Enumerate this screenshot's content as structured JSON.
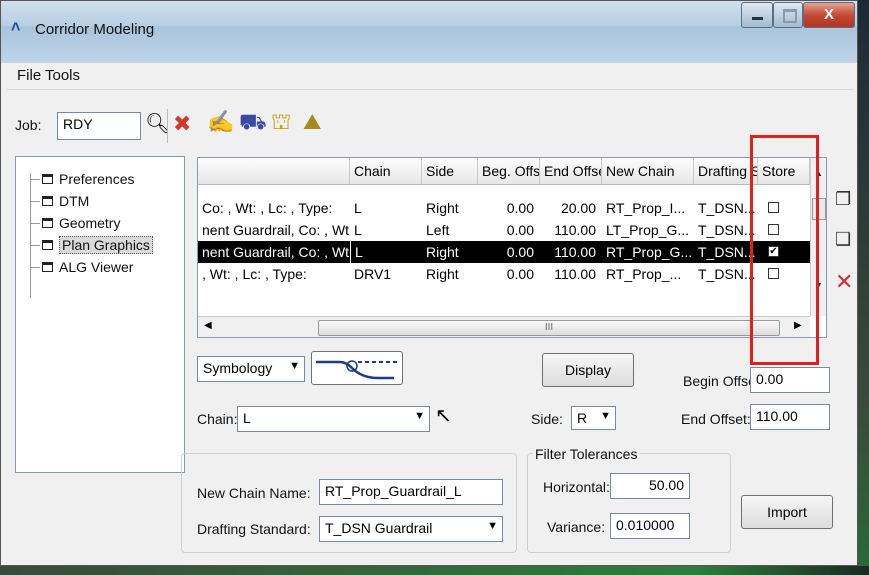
{
  "window": {
    "title": "Corridor Modeling"
  },
  "menu": [
    "File",
    "Tools"
  ],
  "toolbar": {
    "job_label": "Job:",
    "job_value": "RDY"
  },
  "tree": [
    "Preferences",
    "DTM",
    "Geometry",
    "Plan Graphics",
    "ALG Viewer"
  ],
  "grid": {
    "headers": [
      "",
      "Chain",
      "Side",
      "Beg. Offse",
      "End Offse",
      "New Chain",
      "Drafting S",
      "Store"
    ],
    "rows": [
      [
        "Co: , Wt: , Lc: , Type:",
        "L",
        "Right",
        "0.00",
        "20.00",
        "RT_Prop_I...",
        "T_DSN...",
        false
      ],
      [
        "nent Guardrail, Co: , Wt...",
        "L",
        "Left",
        "0.00",
        "110.00",
        "LT_Prop_G...",
        "T_DSN...",
        false
      ],
      [
        "nent Guardrail, Co: , Wt...",
        "L",
        "Right",
        "0.00",
        "110.00",
        "RT_Prop_G...",
        "T_DSN...",
        true
      ],
      [
        ", Wt: , Lc: , Type:",
        "DRV1",
        "Right",
        "0.00",
        "110.00",
        "RT_Prop_...",
        "T_DSN...",
        false
      ]
    ],
    "scroll_thumb": "III"
  },
  "form": {
    "symbology": "Symbology",
    "chain_label": "Chain:",
    "chain_value": "L",
    "display_button": "Display",
    "begin_offset_label": "Begin Offset:",
    "begin_offset_value": "0.00",
    "side_label": "Side:",
    "side_value": "R",
    "end_offset_label": "End Offset:",
    "end_offset_value": "110.00",
    "new_chain_label": "New Chain Name:",
    "new_chain_value": "RT_Prop_Guardrail_L",
    "drafting_label": "Drafting Standard:",
    "drafting_value": "T_DSN Guardrail",
    "filter_title": "Filter Tolerances",
    "horizontal_label": "Horizontal:",
    "horizontal_value": "50.00",
    "variance_label": "Variance:",
    "variance_value": "0.010000",
    "import_button": "Import"
  },
  "colors": {
    "selection_row": "#000000",
    "callout": "#e02020",
    "delete": "#d03030"
  }
}
